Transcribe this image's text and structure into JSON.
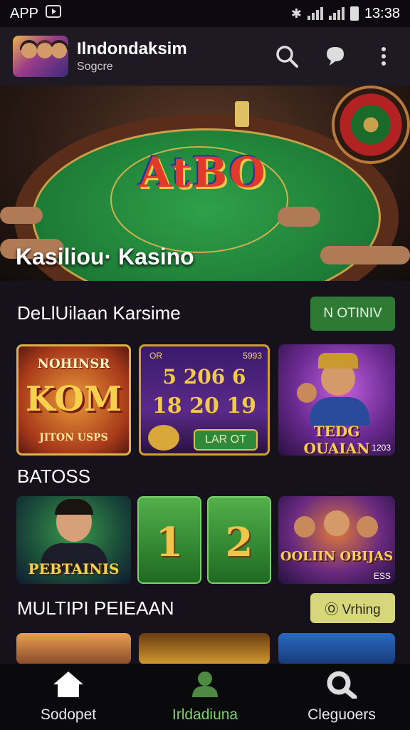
{
  "status_bar": {
    "left_text": "APP",
    "time": "13:38"
  },
  "app_bar": {
    "title": "Ilndondaksim",
    "subtitle": "Sogcre"
  },
  "hero": {
    "logo_text": "AtBO",
    "caption": "Kasiliou· Kasino"
  },
  "section1": {
    "title": "DeLlUilaan Karsime",
    "button": "N OTINIV",
    "tiles": [
      {
        "top": "NOHINSR",
        "main": "KOM",
        "bottom": "JITON USPS"
      },
      {
        "top": "OR",
        "badge": "5993",
        "rows": [
          "5 206 6",
          "18 20 19"
        ],
        "button": "LAR OT"
      },
      {
        "title": "TEDG OUAIAN",
        "badge": "1203"
      }
    ]
  },
  "section2": {
    "title": "BATOSS",
    "tiles": [
      {
        "label": "PEBTAINIS"
      },
      {
        "digit": "1"
      },
      {
        "digit": "2"
      },
      {
        "label": "OOLIIN OBIJAS",
        "badge": "ESS"
      }
    ]
  },
  "section3": {
    "title": "MULTIPI PEIEAAN",
    "button": "Ⓞ Vrhing"
  },
  "bottom_nav": [
    {
      "label": "Sodopet",
      "icon": "home-icon"
    },
    {
      "label": "Irldadiuna",
      "icon": "people-icon"
    },
    {
      "label": "Cleguoers",
      "icon": "key-icon"
    }
  ],
  "colors": {
    "accent_green": "#2e7a34",
    "active_nav": "#7ed06a",
    "yellow_button": "#d6d67a"
  }
}
